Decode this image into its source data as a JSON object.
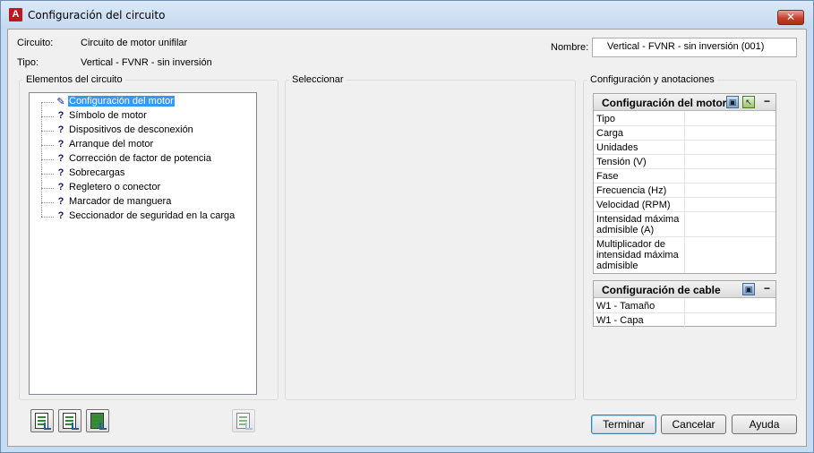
{
  "window": {
    "title": "Configuración del circuito",
    "close_glyph": "✕",
    "app_icon_letter": "A"
  },
  "header": {
    "circuito_label": "Circuito:",
    "circuito_value": "Circuito de motor unifilar",
    "tipo_label": "Tipo:",
    "tipo_value": "Vertical - FVNR - sin inversión",
    "nombre_label": "Nombre:",
    "nombre_value": "Vertical - FVNR - sin inversión (001)"
  },
  "groups": {
    "elementos": "Elementos del circuito",
    "seleccionar": "Seleccionar",
    "configuracion": "Configuración y anotaciones"
  },
  "tree": {
    "items": [
      {
        "icon": "pencil-icon",
        "glyph": "✎",
        "label": "Configuración del motor",
        "selected": true
      },
      {
        "icon": "question-icon",
        "glyph": "?",
        "label": "Símbolo de motor"
      },
      {
        "icon": "question-icon",
        "glyph": "?",
        "label": "Dispositivos de desconexión"
      },
      {
        "icon": "question-icon",
        "glyph": "?",
        "label": "Arranque del motor"
      },
      {
        "icon": "question-icon",
        "glyph": "?",
        "label": "Corrección de factor de potencia"
      },
      {
        "icon": "question-icon",
        "glyph": "?",
        "label": "Sobrecargas"
      },
      {
        "icon": "question-icon",
        "glyph": "?",
        "label": "Regletero o conector"
      },
      {
        "icon": "question-icon",
        "glyph": "?",
        "label": "Marcador de manguera"
      },
      {
        "icon": "question-icon",
        "glyph": "?",
        "label": "Seccionador de seguridad en la carga"
      }
    ]
  },
  "motor_panel": {
    "title": "Configuración del motor",
    "collapse_glyph": "−",
    "rows": [
      {
        "name": "Tipo",
        "value": ""
      },
      {
        "name": "Carga",
        "value": ""
      },
      {
        "name": "Unidades",
        "value": ""
      },
      {
        "name": "Tensión (V)",
        "value": ""
      },
      {
        "name": "Fase",
        "value": ""
      },
      {
        "name": "Frecuencia (Hz)",
        "value": ""
      },
      {
        "name": "Velocidad (RPM)",
        "value": ""
      },
      {
        "name": "Intensidad máxima admisible (A)",
        "value": ""
      },
      {
        "name": "Multiplicador de intensidad máxima admisible",
        "value": ""
      }
    ]
  },
  "cable_panel": {
    "title": "Configuración de cable",
    "collapse_glyph": "−",
    "rows": [
      {
        "name": "W1 - Tamaño",
        "value": ""
      },
      {
        "name": "W1 - Capa",
        "value": ""
      }
    ]
  },
  "buttons": {
    "terminar": "Terminar",
    "cancelar": "Cancelar",
    "ayuda": "Ayuda"
  },
  "colors": {
    "selection": "#3399ff",
    "title_accent": "#c0171d",
    "close_button": "#c7422c"
  }
}
